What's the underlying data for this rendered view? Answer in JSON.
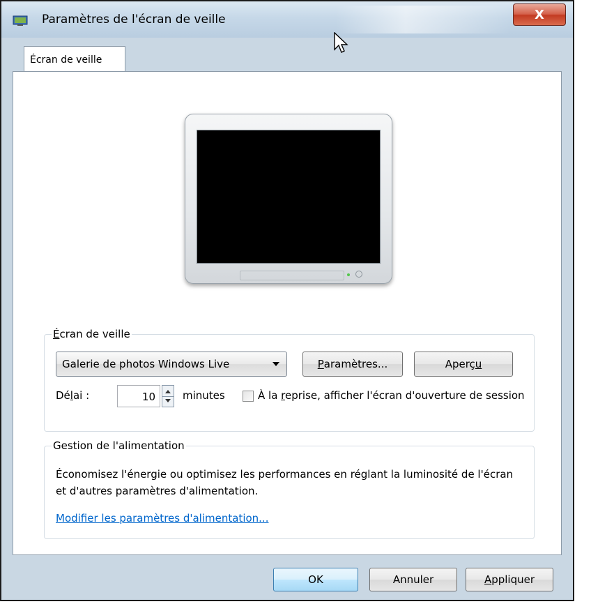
{
  "window": {
    "title": "Paramètres de l'écran de veille",
    "close_label": "X"
  },
  "tabs": [
    {
      "label": "Écran de veille",
      "selected": true
    }
  ],
  "screensaver_group": {
    "title_mnemonic": "É",
    "title_rest": "cran de veille",
    "dropdown_value": "Galerie de photos Windows Live",
    "settings_button_mnemonic": "P",
    "settings_button_rest": "aramètres...",
    "preview_button_main": "Aperç",
    "preview_button_mnemonic": "u",
    "delay_label_pre": "Dé",
    "delay_label_mnemonic": "l",
    "delay_label_post": "ai :",
    "delay_value": "10",
    "minutes_label": "minutes",
    "resume_label_pre": "À la ",
    "resume_label_mnemonic": "r",
    "resume_label_post": "eprise, afficher l'écran d'ouverture de session",
    "resume_checked": false
  },
  "power_group": {
    "title": "Gestion de l'alimentation",
    "description": "Économisez l'énergie ou optimisez les performances en réglant la luminosité de l'écran et d'autres paramètres d'alimentation.",
    "link": "Modifier les paramètres d'alimentation..."
  },
  "buttons": {
    "ok": "OK",
    "cancel": "Annuler",
    "apply_mnemonic": "A",
    "apply_rest": "ppliquer"
  },
  "colors": {
    "titlebar": "#c6d8e8",
    "close_button": "#c23a22",
    "link": "#0066cc",
    "ok_button_border": "#3c7fb1"
  }
}
